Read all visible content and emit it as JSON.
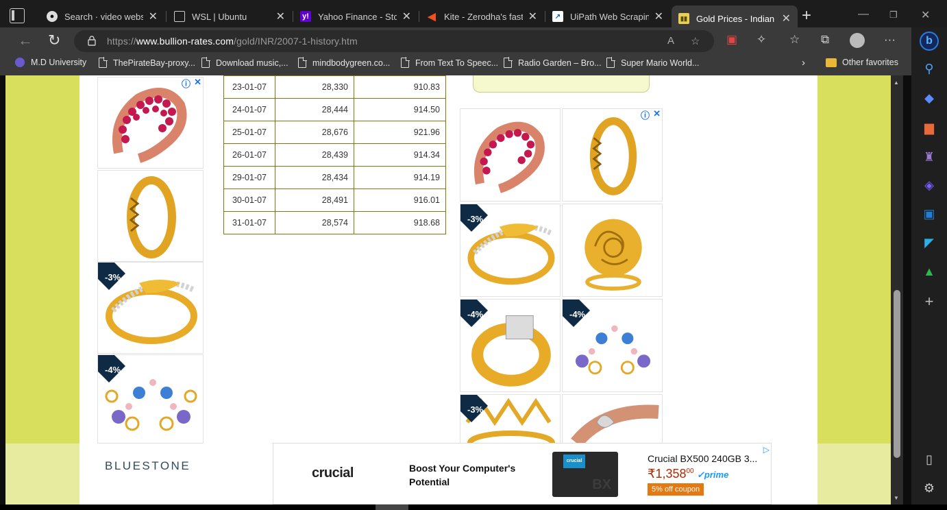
{
  "tabs": [
    {
      "title": "Search · video website",
      "fav": "github"
    },
    {
      "title": "WSL | Ubuntu",
      "fav": "doc"
    },
    {
      "title": "Yahoo Finance - Stock",
      "fav": "yahoo"
    },
    {
      "title": "Kite - Zerodha's fast ar",
      "fav": "kite"
    },
    {
      "title": "UiPath Web Scraping |",
      "fav": "uipath"
    },
    {
      "title": "Gold Prices - Indian Ru",
      "fav": "gold"
    }
  ],
  "address": {
    "prefix": "https://",
    "host": "www.bullion-rates.com",
    "path": "/gold/INR/2007-1-history.htm"
  },
  "favorites": {
    "items": [
      "M.D University",
      "ThePirateBay-proxy...",
      "Download music,...",
      "mindbodygreen.co...",
      "From Text To Speec...",
      "Radio Garden – Bro...",
      "Super Mario World..."
    ],
    "other": "Other favorites"
  },
  "gold_table": {
    "rows": [
      {
        "date": "23-01-07",
        "inr_10g": "28,330",
        "usd_oz": "910.83"
      },
      {
        "date": "24-01-07",
        "inr_10g": "28,444",
        "usd_oz": "914.50"
      },
      {
        "date": "25-01-07",
        "inr_10g": "28,676",
        "usd_oz": "921.96"
      },
      {
        "date": "26-01-07",
        "inr_10g": "28,439",
        "usd_oz": "914.34"
      },
      {
        "date": "29-01-07",
        "inr_10g": "28,434",
        "usd_oz": "914.19"
      },
      {
        "date": "30-01-07",
        "inr_10g": "28,491",
        "usd_oz": "916.01"
      },
      {
        "date": "31-01-07",
        "inr_10g": "28,574",
        "usd_oz": "918.68"
      }
    ]
  },
  "ads": {
    "discounts": {
      "d3": "-3%",
      "d4": "-4%"
    },
    "brand": "BLUESTONE",
    "banner": {
      "logo": "crucial",
      "tagline": "Boost Your Computer's Potential",
      "product": "Crucial BX500 240GB 3...",
      "price_symbol": "₹",
      "price_main": "1,358",
      "price_fraction": "00",
      "prime": "prime",
      "coupon": "5% off coupon"
    }
  },
  "colors": {
    "page_bg": "#d8df5c",
    "table_border": "#7b7a10",
    "price": "#b12704",
    "coupon": "#e47911"
  }
}
